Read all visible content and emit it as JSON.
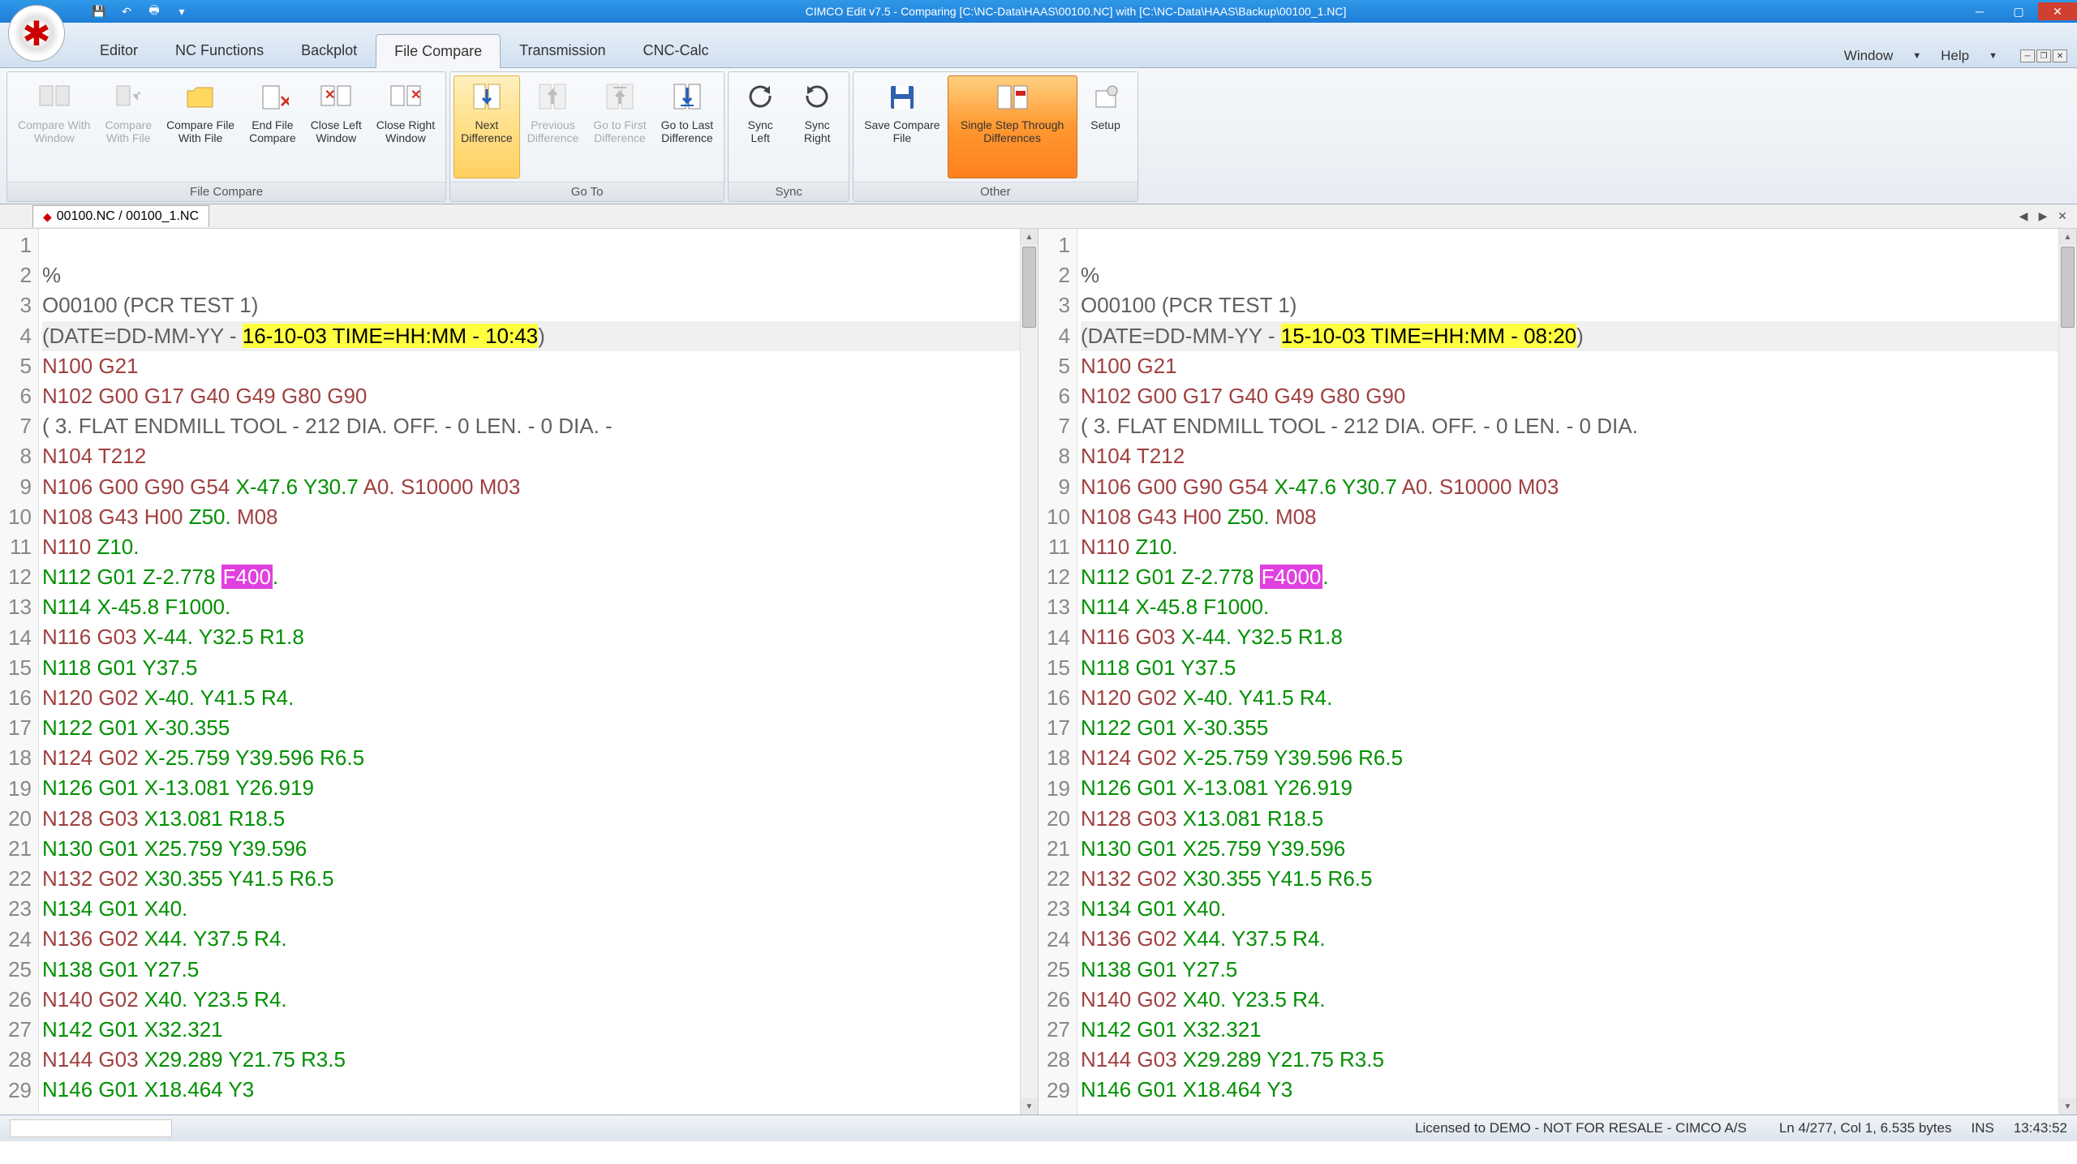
{
  "title": "CIMCO Edit v7.5 - Comparing [C:\\NC-Data\\HAAS\\00100.NC] with [C:\\NC-Data\\HAAS\\Backup\\00100_1.NC]",
  "tabs": {
    "editor": "Editor",
    "nc_functions": "NC Functions",
    "backplot": "Backplot",
    "file_compare": "File Compare",
    "transmission": "Transmission",
    "cnc_calc": "CNC-Calc"
  },
  "menu_right": {
    "window": "Window",
    "help": "Help"
  },
  "ribbon": {
    "file_compare": {
      "label": "File Compare",
      "compare_with_window": "Compare With\nWindow",
      "compare_with_file": "Compare\nWith File",
      "compare_file_with_file": "Compare File\nWith File",
      "end_file_compare": "End File\nCompare",
      "close_left_window": "Close Left\nWindow",
      "close_right_window": "Close Right\nWindow"
    },
    "goto": {
      "label": "Go To",
      "next_difference": "Next\nDifference",
      "previous_difference": "Previous\nDifference",
      "go_to_first_difference": "Go to First\nDifference",
      "go_to_last_difference": "Go to Last\nDifference"
    },
    "sync": {
      "label": "Sync",
      "sync_left": "Sync\nLeft",
      "sync_right": "Sync\nRight"
    },
    "other": {
      "label": "Other",
      "save_compare_file": "Save Compare\nFile",
      "single_step": "Single Step Through\nDifferences",
      "setup": "Setup"
    }
  },
  "doc_tab": "00100.NC / 00100_1.NC",
  "left_lines": [
    {
      "n": 1,
      "segs": [
        {
          "t": " ",
          "c": ""
        }
      ]
    },
    {
      "n": 2,
      "segs": [
        {
          "t": "%",
          "c": "comment"
        }
      ]
    },
    {
      "n": 3,
      "segs": [
        {
          "t": "O00100 (PCR TEST 1)",
          "c": "onum"
        }
      ]
    },
    {
      "n": 4,
      "cur": true,
      "segs": [
        {
          "t": "(DATE=DD-MM-YY - ",
          "c": "comment"
        },
        {
          "t": "16-10-03 TIME=HH:MM - 10:43",
          "c": "diff-yellow"
        },
        {
          "t": ")",
          "c": "comment"
        }
      ]
    },
    {
      "n": 5,
      "segs": [
        {
          "t": "N100 ",
          "c": "n-word"
        },
        {
          "t": "G21",
          "c": "g-word"
        }
      ]
    },
    {
      "n": 6,
      "segs": [
        {
          "t": "N102 ",
          "c": "n-word"
        },
        {
          "t": "G00 G17 G40 G49 G80 G90",
          "c": "g-word"
        }
      ]
    },
    {
      "n": 7,
      "segs": [
        {
          "t": "( 3. FLAT ENDMILL TOOL - 212 DIA. OFF. - 0 LEN. - 0 DIA. -",
          "c": "comment"
        }
      ]
    },
    {
      "n": 8,
      "segs": [
        {
          "t": "N104 ",
          "c": "n-word"
        },
        {
          "t": "T212",
          "c": "tool"
        }
      ]
    },
    {
      "n": 9,
      "segs": [
        {
          "t": "N106 ",
          "c": "n-word"
        },
        {
          "t": "G00 G90 G54 ",
          "c": "g-word"
        },
        {
          "t": "X-47.6 Y30.7 ",
          "c": "coord"
        },
        {
          "t": "A0. ",
          "c": "g-word"
        },
        {
          "t": "S10000 M03",
          "c": "spindle"
        }
      ]
    },
    {
      "n": 10,
      "segs": [
        {
          "t": "N108 ",
          "c": "n-word"
        },
        {
          "t": "G43 H00 ",
          "c": "g-word"
        },
        {
          "t": "Z50. ",
          "c": "coord"
        },
        {
          "t": "M08",
          "c": "misc"
        }
      ]
    },
    {
      "n": 11,
      "segs": [
        {
          "t": "N110 ",
          "c": "n-word"
        },
        {
          "t": "Z10.",
          "c": "coord"
        }
      ]
    },
    {
      "n": 12,
      "segs": [
        {
          "t": "N112 ",
          "c": "text-green"
        },
        {
          "t": "G01 ",
          "c": "text-green"
        },
        {
          "t": "Z-2.778 ",
          "c": "text-green"
        },
        {
          "t": "F400",
          "c": "diff-magenta"
        },
        {
          "t": ".",
          "c": "text-green"
        }
      ]
    },
    {
      "n": 13,
      "segs": [
        {
          "t": "N114 ",
          "c": "text-green"
        },
        {
          "t": "X-45.8 ",
          "c": "text-green"
        },
        {
          "t": "F1000.",
          "c": "text-green"
        }
      ]
    },
    {
      "n": 14,
      "segs": [
        {
          "t": "N116 ",
          "c": "n-word"
        },
        {
          "t": "G03 ",
          "c": "g-word"
        },
        {
          "t": "X-44. Y32.5 R1.8",
          "c": "coord"
        }
      ]
    },
    {
      "n": 15,
      "segs": [
        {
          "t": "N118 ",
          "c": "text-green"
        },
        {
          "t": "G01 ",
          "c": "text-green"
        },
        {
          "t": "Y37.5",
          "c": "text-green"
        }
      ]
    },
    {
      "n": 16,
      "segs": [
        {
          "t": "N120 ",
          "c": "n-word"
        },
        {
          "t": "G02 ",
          "c": "g-word"
        },
        {
          "t": "X-40. Y41.5 R4.",
          "c": "coord"
        }
      ]
    },
    {
      "n": 17,
      "segs": [
        {
          "t": "N122 ",
          "c": "text-green"
        },
        {
          "t": "G01 ",
          "c": "text-green"
        },
        {
          "t": "X-30.355",
          "c": "text-green"
        }
      ]
    },
    {
      "n": 18,
      "segs": [
        {
          "t": "N124 ",
          "c": "n-word"
        },
        {
          "t": "G02 ",
          "c": "g-word"
        },
        {
          "t": "X-25.759 Y39.596 R6.5",
          "c": "coord"
        }
      ]
    },
    {
      "n": 19,
      "segs": [
        {
          "t": "N126 ",
          "c": "text-green"
        },
        {
          "t": "G01 ",
          "c": "text-green"
        },
        {
          "t": "X-13.081 Y26.919",
          "c": "text-green"
        }
      ]
    },
    {
      "n": 20,
      "segs": [
        {
          "t": "N128 ",
          "c": "n-word"
        },
        {
          "t": "G03 ",
          "c": "g-word"
        },
        {
          "t": "X13.081 R18.5",
          "c": "coord"
        }
      ]
    },
    {
      "n": 21,
      "segs": [
        {
          "t": "N130 ",
          "c": "text-green"
        },
        {
          "t": "G01 ",
          "c": "text-green"
        },
        {
          "t": "X25.759 Y39.596",
          "c": "text-green"
        }
      ]
    },
    {
      "n": 22,
      "segs": [
        {
          "t": "N132 ",
          "c": "n-word"
        },
        {
          "t": "G02 ",
          "c": "g-word"
        },
        {
          "t": "X30.355 Y41.5 R6.5",
          "c": "coord"
        }
      ]
    },
    {
      "n": 23,
      "segs": [
        {
          "t": "N134 ",
          "c": "text-green"
        },
        {
          "t": "G01 ",
          "c": "text-green"
        },
        {
          "t": "X40.",
          "c": "text-green"
        }
      ]
    },
    {
      "n": 24,
      "segs": [
        {
          "t": "N136 ",
          "c": "n-word"
        },
        {
          "t": "G02 ",
          "c": "g-word"
        },
        {
          "t": "X44. Y37.5 R4.",
          "c": "coord"
        }
      ]
    },
    {
      "n": 25,
      "segs": [
        {
          "t": "N138 ",
          "c": "text-green"
        },
        {
          "t": "G01 ",
          "c": "text-green"
        },
        {
          "t": "Y27.5",
          "c": "text-green"
        }
      ]
    },
    {
      "n": 26,
      "segs": [
        {
          "t": "N140 ",
          "c": "n-word"
        },
        {
          "t": "G02 ",
          "c": "g-word"
        },
        {
          "t": "X40. Y23.5 R4.",
          "c": "coord"
        }
      ]
    },
    {
      "n": 27,
      "segs": [
        {
          "t": "N142 ",
          "c": "text-green"
        },
        {
          "t": "G01 ",
          "c": "text-green"
        },
        {
          "t": "X32.321",
          "c": "text-green"
        }
      ]
    },
    {
      "n": 28,
      "segs": [
        {
          "t": "N144 ",
          "c": "n-word"
        },
        {
          "t": "G03 ",
          "c": "g-word"
        },
        {
          "t": "X29.289 Y21.75 R3.5",
          "c": "coord"
        }
      ]
    },
    {
      "n": 29,
      "segs": [
        {
          "t": "N146 ",
          "c": "text-green"
        },
        {
          "t": "G01 ",
          "c": "text-green"
        },
        {
          "t": "X18.464 Y3",
          "c": "text-green"
        }
      ]
    }
  ],
  "right_lines": [
    {
      "n": 1,
      "segs": [
        {
          "t": " ",
          "c": ""
        }
      ]
    },
    {
      "n": 2,
      "segs": [
        {
          "t": "%",
          "c": "comment"
        }
      ]
    },
    {
      "n": 3,
      "segs": [
        {
          "t": "O00100 (PCR TEST 1)",
          "c": "onum"
        }
      ]
    },
    {
      "n": 4,
      "cur": true,
      "segs": [
        {
          "t": "(DATE=DD-MM-YY - ",
          "c": "comment"
        },
        {
          "t": "15-10-03 TIME=HH:MM - 08:20",
          "c": "diff-yellow"
        },
        {
          "t": ")",
          "c": "comment"
        }
      ]
    },
    {
      "n": 5,
      "segs": [
        {
          "t": "N100 ",
          "c": "n-word"
        },
        {
          "t": "G21",
          "c": "g-word"
        }
      ]
    },
    {
      "n": 6,
      "segs": [
        {
          "t": "N102 ",
          "c": "n-word"
        },
        {
          "t": "G00 G17 G40 G49 G80 G90",
          "c": "g-word"
        }
      ]
    },
    {
      "n": 7,
      "segs": [
        {
          "t": "( 3. FLAT ENDMILL TOOL - 212 DIA. OFF. - 0 LEN. - 0 DIA.",
          "c": "comment"
        }
      ]
    },
    {
      "n": 8,
      "segs": [
        {
          "t": "N104 ",
          "c": "n-word"
        },
        {
          "t": "T212",
          "c": "tool"
        }
      ]
    },
    {
      "n": 9,
      "segs": [
        {
          "t": "N106 ",
          "c": "n-word"
        },
        {
          "t": "G00 G90 G54 ",
          "c": "g-word"
        },
        {
          "t": "X-47.6 Y30.7 ",
          "c": "coord"
        },
        {
          "t": "A0. ",
          "c": "g-word"
        },
        {
          "t": "S10000 M03",
          "c": "spindle"
        }
      ]
    },
    {
      "n": 10,
      "segs": [
        {
          "t": "N108 ",
          "c": "n-word"
        },
        {
          "t": "G43 H00 ",
          "c": "g-word"
        },
        {
          "t": "Z50. ",
          "c": "coord"
        },
        {
          "t": "M08",
          "c": "misc"
        }
      ]
    },
    {
      "n": 11,
      "segs": [
        {
          "t": "N110 ",
          "c": "n-word"
        },
        {
          "t": "Z10.",
          "c": "coord"
        }
      ]
    },
    {
      "n": 12,
      "segs": [
        {
          "t": "N112 ",
          "c": "text-green"
        },
        {
          "t": "G01 ",
          "c": "text-green"
        },
        {
          "t": "Z-2.778 ",
          "c": "text-green"
        },
        {
          "t": "F4000",
          "c": "diff-magenta"
        },
        {
          "t": ".",
          "c": "text-green"
        }
      ]
    },
    {
      "n": 13,
      "segs": [
        {
          "t": "N114 ",
          "c": "text-green"
        },
        {
          "t": "X-45.8 ",
          "c": "text-green"
        },
        {
          "t": "F1000.",
          "c": "text-green"
        }
      ]
    },
    {
      "n": 14,
      "segs": [
        {
          "t": "N116 ",
          "c": "n-word"
        },
        {
          "t": "G03 ",
          "c": "g-word"
        },
        {
          "t": "X-44. Y32.5 R1.8",
          "c": "coord"
        }
      ]
    },
    {
      "n": 15,
      "segs": [
        {
          "t": "N118 ",
          "c": "text-green"
        },
        {
          "t": "G01 ",
          "c": "text-green"
        },
        {
          "t": "Y37.5",
          "c": "text-green"
        }
      ]
    },
    {
      "n": 16,
      "segs": [
        {
          "t": "N120 ",
          "c": "n-word"
        },
        {
          "t": "G02 ",
          "c": "g-word"
        },
        {
          "t": "X-40. Y41.5 R4.",
          "c": "coord"
        }
      ]
    },
    {
      "n": 17,
      "segs": [
        {
          "t": "N122 ",
          "c": "text-green"
        },
        {
          "t": "G01 ",
          "c": "text-green"
        },
        {
          "t": "X-30.355",
          "c": "text-green"
        }
      ]
    },
    {
      "n": 18,
      "segs": [
        {
          "t": "N124 ",
          "c": "n-word"
        },
        {
          "t": "G02 ",
          "c": "g-word"
        },
        {
          "t": "X-25.759 Y39.596 R6.5",
          "c": "coord"
        }
      ]
    },
    {
      "n": 19,
      "segs": [
        {
          "t": "N126 ",
          "c": "text-green"
        },
        {
          "t": "G01 ",
          "c": "text-green"
        },
        {
          "t": "X-13.081 Y26.919",
          "c": "text-green"
        }
      ]
    },
    {
      "n": 20,
      "segs": [
        {
          "t": "N128 ",
          "c": "n-word"
        },
        {
          "t": "G03 ",
          "c": "g-word"
        },
        {
          "t": "X13.081 R18.5",
          "c": "coord"
        }
      ]
    },
    {
      "n": 21,
      "segs": [
        {
          "t": "N130 ",
          "c": "text-green"
        },
        {
          "t": "G01 ",
          "c": "text-green"
        },
        {
          "t": "X25.759 Y39.596",
          "c": "text-green"
        }
      ]
    },
    {
      "n": 22,
      "segs": [
        {
          "t": "N132 ",
          "c": "n-word"
        },
        {
          "t": "G02 ",
          "c": "g-word"
        },
        {
          "t": "X30.355 Y41.5 R6.5",
          "c": "coord"
        }
      ]
    },
    {
      "n": 23,
      "segs": [
        {
          "t": "N134 ",
          "c": "text-green"
        },
        {
          "t": "G01 ",
          "c": "text-green"
        },
        {
          "t": "X40.",
          "c": "text-green"
        }
      ]
    },
    {
      "n": 24,
      "segs": [
        {
          "t": "N136 ",
          "c": "n-word"
        },
        {
          "t": "G02 ",
          "c": "g-word"
        },
        {
          "t": "X44. Y37.5 R4.",
          "c": "coord"
        }
      ]
    },
    {
      "n": 25,
      "segs": [
        {
          "t": "N138 ",
          "c": "text-green"
        },
        {
          "t": "G01 ",
          "c": "text-green"
        },
        {
          "t": "Y27.5",
          "c": "text-green"
        }
      ]
    },
    {
      "n": 26,
      "segs": [
        {
          "t": "N140 ",
          "c": "n-word"
        },
        {
          "t": "G02 ",
          "c": "g-word"
        },
        {
          "t": "X40. Y23.5 R4.",
          "c": "coord"
        }
      ]
    },
    {
      "n": 27,
      "segs": [
        {
          "t": "N142 ",
          "c": "text-green"
        },
        {
          "t": "G01 ",
          "c": "text-green"
        },
        {
          "t": "X32.321",
          "c": "text-green"
        }
      ]
    },
    {
      "n": 28,
      "segs": [
        {
          "t": "N144 ",
          "c": "n-word"
        },
        {
          "t": "G03 ",
          "c": "g-word"
        },
        {
          "t": "X29.289 Y21.75 R3.5",
          "c": "coord"
        }
      ]
    },
    {
      "n": 29,
      "segs": [
        {
          "t": "N146 ",
          "c": "text-green"
        },
        {
          "t": "G01 ",
          "c": "text-green"
        },
        {
          "t": "X18.464 Y3",
          "c": "text-green"
        }
      ]
    }
  ],
  "status": {
    "license": "Licensed to DEMO - NOT FOR RESALE - CIMCO A/S",
    "pos": "Ln 4/277, Col 1, 6.535 bytes",
    "ins": "INS",
    "time": "13:43:52"
  }
}
